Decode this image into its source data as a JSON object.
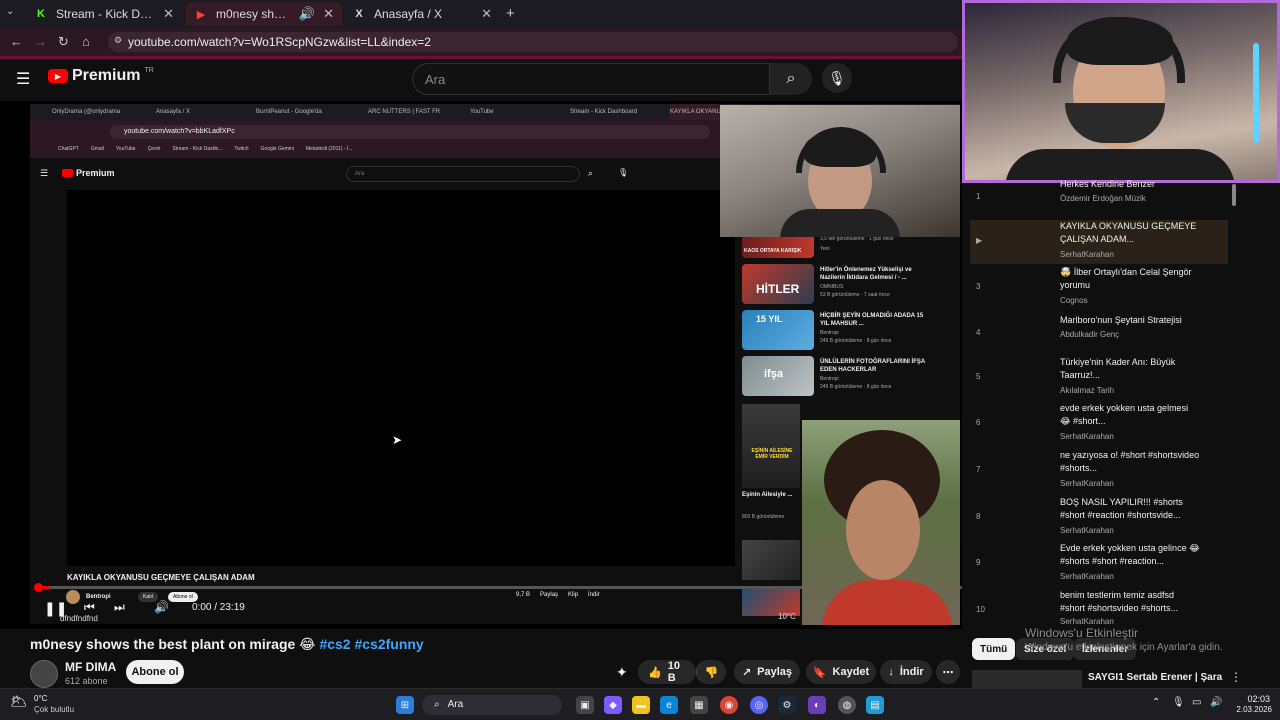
{
  "browser": {
    "tabs": [
      {
        "label": "Stream - Kick Dashboard",
        "icon": "kick-icon",
        "active": false
      },
      {
        "label": "m0nesy shows the best plant on mirage",
        "icon": "youtube-icon",
        "active": true
      },
      {
        "label": "Anasayfa / X",
        "icon": "x-icon",
        "active": false
      }
    ],
    "url": "youtube.com/watch?v=Wo1RScpNGzw&list=LL&index=2"
  },
  "youtube": {
    "logo_text": "Premium",
    "logo_badge": "TR",
    "search_placeholder": "Ara"
  },
  "nested_browser": {
    "tabs": [
      "OnlyDrama (@onlydrama",
      "Anasayfa / X",
      "BurntPeanut - Google'da",
      "ARC NUTTERS | FAST FR",
      "YouTube",
      "Stream - Kick Dashboard",
      "KAYIKLA OKYANUSU"
    ],
    "url": "youtube.com/watch?v=bbKLadfXPc",
    "bookmarks": [
      "ChatGPT",
      "Gmail",
      "YouTube",
      "Çeviri",
      "Stream - Kick Dashb...",
      "Twitch",
      "Google Gemini",
      "Melankoli (2011) - İ..."
    ],
    "logo_text": "Premium",
    "search_placeholder": "Ara",
    "video_title": "KAYIKLA OKYANUSU GEÇMEYE ÇALIŞAN ADAM",
    "channel": "Bentropi",
    "subscribe": "Abone ol",
    "join": "Katıl",
    "time": "0:00 / 23:19",
    "likes": "9,7 B",
    "share": "Paylaş",
    "clip": "Klip",
    "download": "İndir",
    "side_videos": [
      {
        "title": "KAOS ORTAYA KARIŞIK",
        "meta": "3,5 Mn görüntüleme · 1 gün önce",
        "badge": "Yeni",
        "duration": "52:49"
      },
      {
        "title": "Hitler'in Önlenemez Yükselişi ve Nazilerin İktidara Gelmesi / - ...",
        "channel": "OMNIBUS",
        "meta": "53 B görüntüleme · 7 saat önce",
        "badge": "Yeni",
        "duration": "1:15:36",
        "thumb_text": "HİTLER"
      },
      {
        "title": "HİÇBİR ŞEYİN OLMADIĞI ADADA 15 YIL MAHSUR ...",
        "channel": "Bentropi",
        "meta": "249 B görüntüleme · 8 gün önce",
        "duration": "17:45",
        "thumb_text": "15 YIL"
      },
      {
        "title": "ÜNLÜLERİN FOTOĞRAFLARINI İFŞA EDEN HACKERLAR",
        "channel": "Bentropi",
        "meta": "249 B görüntüleme · 8 gün önce",
        "duration": "16:50",
        "thumb_text": "ifşa"
      },
      {
        "title": "Eşinin Ailesiyle ...",
        "meta": "803 B görüntüleme",
        "thumb_text": "EŞİNİN AİLESİNE EMİR VERDİM"
      }
    ]
  },
  "player": {
    "weather_small": "10°C",
    "taskbar_user": "dfndfndfnd"
  },
  "video": {
    "title": "m0nesy shows the best plant on mirage 😂",
    "tags": "#cs2 #cs2funny",
    "channel_name": "MF DIMA",
    "subscribers": "612 abone",
    "subscribe_label": "Abone ol",
    "likes": "10 B",
    "share_label": "Paylaş",
    "save_label": "Kaydet",
    "download_label": "İndir"
  },
  "playlist": {
    "items": [
      {
        "index": "1",
        "title": "Herkes Kendine Benzer",
        "channel": "Özdemir Erdoğan Müzik"
      },
      {
        "index": "▶",
        "title": "KAYIKLA OKYANUSU GEÇMEYE ÇALIŞAN ADAM...",
        "channel": "SerhatKarahan",
        "active": true
      },
      {
        "index": "3",
        "title": "🤯 İlber Ortaylı'dan Celal Şengör yorumu",
        "channel": "Cognos"
      },
      {
        "index": "4",
        "title": "Marlboro'nun Şeytani Stratejisi",
        "channel": "Abdulkadir Genç"
      },
      {
        "index": "5",
        "title": "Türkiye'nin Kader Anı: Büyük Taarruz!...",
        "channel": "Akılalmaz Tarih"
      },
      {
        "index": "6",
        "title": "evde erkek yokken usta gelmesi 😂 #short...",
        "channel": "SerhatKarahan"
      },
      {
        "index": "7",
        "title": "ne yazıyosa o! #short #shortsvideo #shorts...",
        "channel": "SerhatKarahan"
      },
      {
        "index": "8",
        "title": "BOŞ NASIL YAPILIR!!! #shorts #short #reaction #shortsvide...",
        "channel": "SerhatKarahan"
      },
      {
        "index": "9",
        "title": "Evde erkek yokken usta gelince 😂 #shorts #short #reaction...",
        "channel": "SerhatKarahan"
      },
      {
        "index": "10",
        "title": "benim testlerim temiz asdfsd #short #shortsvideo #shorts...",
        "channel": "SerhatKarahan"
      }
    ],
    "chips": [
      "Tümü",
      "Size özel",
      "İzlenenler"
    ],
    "next_item": "SAYGI1 Sertab Erener | Şara"
  },
  "windows": {
    "activation_line1": "Windows'u Etkinleştir",
    "activation_line2": "Windows'u etkinleştirmek için Ayarlar'a gidin.",
    "weather_temp": "0°C",
    "weather_desc": "Çok bulutlu",
    "search_label": "Ara",
    "time": "02:03",
    "date": "2.03.2026"
  },
  "colors": {
    "yt_red": "#ff0000",
    "link_blue": "#3ea6ff",
    "cam_border": "#b06bd8",
    "address_bar": "#2b1822"
  }
}
